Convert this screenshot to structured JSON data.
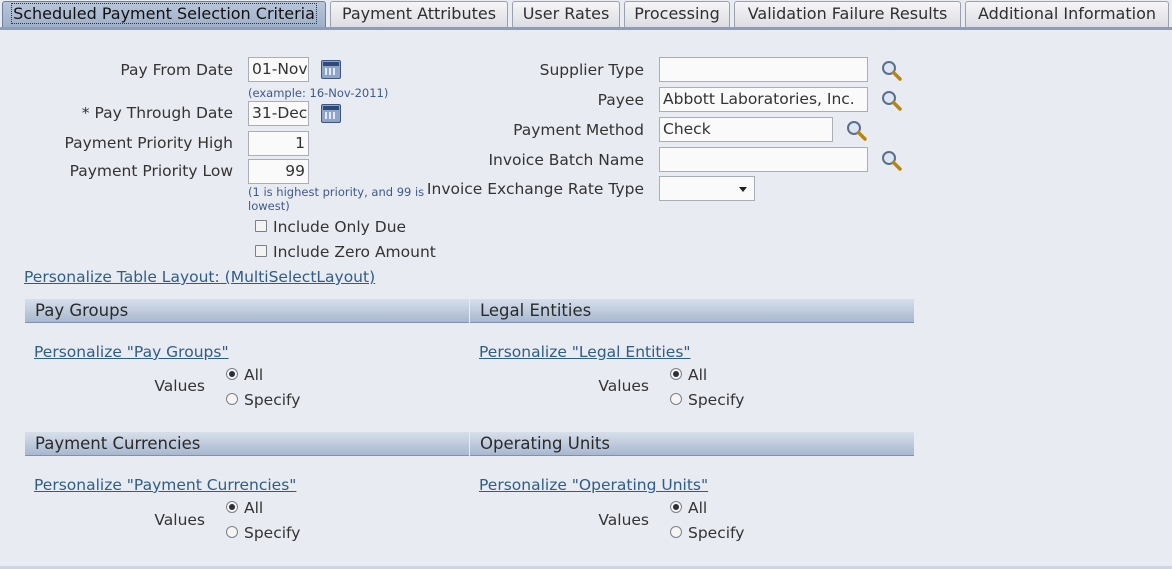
{
  "tabs": [
    {
      "label": "Scheduled Payment Selection Criteria",
      "active": true
    },
    {
      "label": "Payment Attributes"
    },
    {
      "label": "User Rates"
    },
    {
      "label": "Processing"
    },
    {
      "label": "Validation Failure Results"
    },
    {
      "label": "Additional Information"
    }
  ],
  "form": {
    "pay_from_date": {
      "label": "Pay From Date",
      "value": "01-Nov-",
      "hint": "(example: 16-Nov-2011)"
    },
    "pay_through_date": {
      "label": "* Pay Through Date",
      "value": "31-Dec-"
    },
    "priority_high": {
      "label": "Payment Priority High",
      "value": "1"
    },
    "priority_low": {
      "label": "Payment Priority Low",
      "value": "99",
      "hint_line1": "(1 is highest priority, and 99 is",
      "hint_line2": "lowest)"
    },
    "include_only_due": {
      "label": "Include Only Due",
      "checked": false
    },
    "include_zero_amount": {
      "label": "Include Zero Amount",
      "checked": false
    },
    "supplier_type": {
      "label": "Supplier Type",
      "value": ""
    },
    "payee": {
      "label": "Payee",
      "value": "Abbott Laboratories, Inc."
    },
    "payment_method": {
      "label": "Payment Method",
      "value": "Check"
    },
    "invoice_batch_name": {
      "label": "Invoice Batch Name",
      "value": ""
    },
    "exchange_rate_type": {
      "label": "Invoice Exchange Rate Type",
      "value": ""
    }
  },
  "personalize_table_layout": "Personalize Table Layout: (MultiSelectLayout)",
  "sections": {
    "pay_groups": {
      "title": "Pay Groups",
      "link": "Personalize \"Pay Groups\"",
      "values_label": "Values",
      "all": "All",
      "specify": "Specify"
    },
    "legal_entities": {
      "title": "Legal Entities",
      "link": "Personalize \"Legal Entities\"",
      "values_label": "Values",
      "all": "All",
      "specify": "Specify"
    },
    "payment_currencies": {
      "title": "Payment Currencies",
      "link": "Personalize \"Payment Currencies\"",
      "values_label": "Values",
      "all": "All",
      "specify": "Specify"
    },
    "operating_units": {
      "title": "Operating Units",
      "link": "Personalize \"Operating Units\"",
      "values_label": "Values",
      "all": "All",
      "specify": "Specify"
    }
  },
  "colors": {
    "accent": "#8b9dbb",
    "link": "#2f5d86",
    "section_header": "#a8b8cf"
  },
  "icons": {
    "calendar": "calendar-icon",
    "search": "search-icon"
  }
}
